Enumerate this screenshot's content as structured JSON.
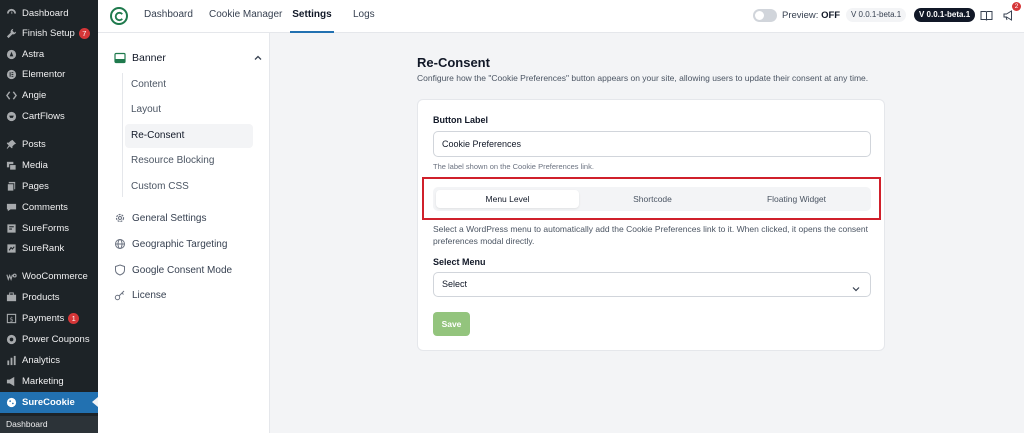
{
  "wp_sidebar": {
    "items": [
      {
        "label": "Dashboard",
        "icon": "dashboard-icon"
      },
      {
        "label": "Finish Setup",
        "icon": "wrench-icon",
        "badge": "7"
      },
      {
        "label": "Astra",
        "icon": "astra-icon"
      },
      {
        "label": "Elementor",
        "icon": "elementor-icon"
      },
      {
        "label": "Angie",
        "icon": "angie-icon"
      },
      {
        "label": "CartFlows",
        "icon": "cartflows-icon"
      },
      {
        "label": "Posts",
        "icon": "pin-icon"
      },
      {
        "label": "Media",
        "icon": "media-icon"
      },
      {
        "label": "Pages",
        "icon": "pages-icon"
      },
      {
        "label": "Comments",
        "icon": "comment-icon"
      },
      {
        "label": "SureForms",
        "icon": "sureforms-icon"
      },
      {
        "label": "SureRank",
        "icon": "surerank-icon"
      },
      {
        "label": "WooCommerce",
        "icon": "woocommerce-icon"
      },
      {
        "label": "Products",
        "icon": "products-icon"
      },
      {
        "label": "Payments",
        "icon": "payments-icon",
        "badge": "1"
      },
      {
        "label": "Power Coupons",
        "icon": "coupon-icon"
      },
      {
        "label": "Analytics",
        "icon": "analytics-icon"
      },
      {
        "label": "Marketing",
        "icon": "megaphone-icon"
      },
      {
        "label": "SureCookie",
        "icon": "cookie-icon"
      }
    ],
    "submenu_label": "Dashboard"
  },
  "header": {
    "tabs": [
      "Dashboard",
      "Cookie Manager",
      "Settings",
      "Logs"
    ],
    "active_tab": "Settings",
    "preview_label": "Preview:",
    "preview_state": "OFF",
    "version_light": "V 0.0.1-beta.1",
    "version_dark": "V 0.0.1-beta.1",
    "notification_count": "2"
  },
  "plugin_menu": {
    "section": "Banner",
    "subitems": [
      "Content",
      "Layout",
      "Re-Consent",
      "Resource Blocking",
      "Custom CSS"
    ],
    "active_subitem": "Re-Consent",
    "items": [
      "General Settings",
      "Geographic Targeting",
      "Google Consent Mode",
      "License"
    ]
  },
  "main": {
    "title": "Re-Consent",
    "description": "Configure how the \"Cookie Preferences\" button appears on your site, allowing users to update their consent at any time.",
    "button_label_title": "Button Label",
    "button_label_value": "Cookie Preferences",
    "button_label_help": "The label shown on the Cookie Preferences link.",
    "segments": [
      "Menu Level",
      "Shortcode",
      "Floating Widget"
    ],
    "active_segment": "Menu Level",
    "segment_description": "Select a WordPress menu to automatically add the Cookie Preferences link to it. When clicked, it opens the consent preferences modal directly.",
    "select_menu_label": "Select Menu",
    "select_menu_value": "Select",
    "save_label": "Save"
  },
  "colors": {
    "wp_sidebar_bg": "#1d2327",
    "wp_active": "#2271b1",
    "highlight_border": "#d0202b",
    "save_button": "#93c47d",
    "badge": "#d63638"
  }
}
